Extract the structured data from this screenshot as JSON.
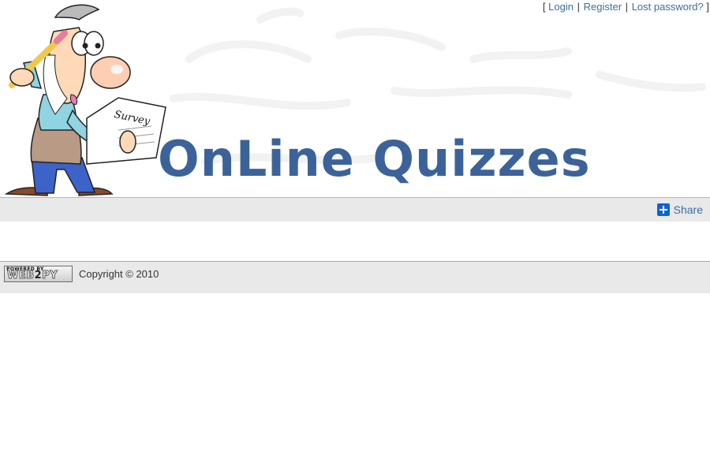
{
  "auth_nav": {
    "open_bracket": "[",
    "login": "Login",
    "separator": "|",
    "register": "Register",
    "lost_password": "Lost password?",
    "close_bracket": "]"
  },
  "header": {
    "title": "OnLine Quizzes",
    "mascot_sheet_text": "Survey",
    "title_color": "#3c6399"
  },
  "share": {
    "label": "Share",
    "icon": "plus-icon"
  },
  "footer": {
    "badge_top": "POWERED BY",
    "badge_main_a": "WEB",
    "badge_main_b": "2",
    "badge_main_c": "PY",
    "copyright": "Copyright © 2010"
  },
  "colors": {
    "link": "#3c6ea3",
    "bar_bg": "#e9e9e9",
    "share_icon": "#0f62d2"
  }
}
